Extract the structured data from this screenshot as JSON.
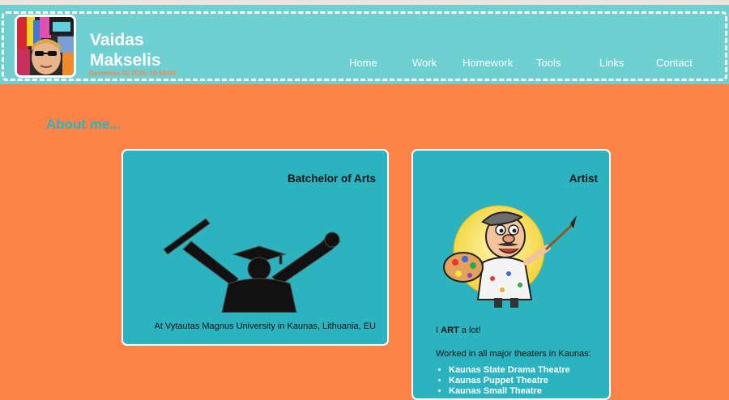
{
  "header": {
    "first_name": "Vaidas",
    "last_name": "Makselis",
    "date": "December 02 2015, 10:54AM"
  },
  "nav": {
    "items": [
      {
        "label": "Home"
      },
      {
        "label": "Work"
      },
      {
        "label": "Homework"
      },
      {
        "label": "Tools"
      },
      {
        "label": "Links"
      },
      {
        "label": "Contact"
      }
    ]
  },
  "about": {
    "title": "About me..."
  },
  "cards": {
    "arts": {
      "title": "Batchelor of Arts",
      "caption": "At Vytautas Magnus University in Kaunas, Lithuania, EU"
    },
    "artist": {
      "title": "Artist",
      "line1_pre": "I ",
      "line1_bold": "ART",
      "line1_post": " a lot!",
      "line2": "Worked in all major theaters in Kaunas:",
      "theaters": [
        "Kaunas State Drama Theatre",
        "Kaunas Puppet Theatre",
        "Kaunas Small Theatre"
      ]
    }
  },
  "colors": {
    "background": "#fb8347",
    "header": "#6fd0d2",
    "card": "#2bb4c0",
    "accent_text": "#2bb4c0"
  }
}
